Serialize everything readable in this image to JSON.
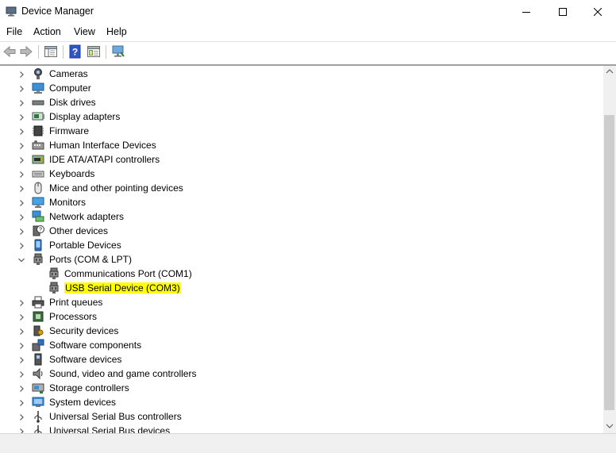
{
  "window": {
    "title": "Device Manager"
  },
  "menu": [
    "File",
    "Action",
    "View",
    "Help"
  ],
  "toolbar": [
    "back-icon",
    "forward-icon",
    "show-hide-tree-icon",
    "help-icon",
    "properties-icon",
    "scan-hardware-icon"
  ],
  "tree": [
    {
      "label": "Cameras",
      "icon": "camera-icon",
      "expanded": false
    },
    {
      "label": "Computer",
      "icon": "computer-icon",
      "expanded": false
    },
    {
      "label": "Disk drives",
      "icon": "disk-drive-icon",
      "expanded": false
    },
    {
      "label": "Display adapters",
      "icon": "display-adapter-icon",
      "expanded": false
    },
    {
      "label": "Firmware",
      "icon": "firmware-icon",
      "expanded": false
    },
    {
      "label": "Human Interface Devices",
      "icon": "hid-icon",
      "expanded": false
    },
    {
      "label": "IDE ATA/ATAPI controllers",
      "icon": "ide-controller-icon",
      "expanded": false
    },
    {
      "label": "Keyboards",
      "icon": "keyboard-icon",
      "expanded": false
    },
    {
      "label": "Mice and other pointing devices",
      "icon": "mouse-icon",
      "expanded": false
    },
    {
      "label": "Monitors",
      "icon": "monitor-icon",
      "expanded": false
    },
    {
      "label": "Network adapters",
      "icon": "network-adapter-icon",
      "expanded": false
    },
    {
      "label": "Other devices",
      "icon": "unknown-device-icon",
      "expanded": false
    },
    {
      "label": "Portable Devices",
      "icon": "portable-device-icon",
      "expanded": false
    },
    {
      "label": "Ports (COM & LPT)",
      "icon": "port-icon",
      "expanded": true,
      "children": [
        {
          "label": "Communications Port (COM1)",
          "icon": "port-icon",
          "highlighted": false
        },
        {
          "label": "USB Serial Device (COM3)",
          "icon": "port-icon",
          "highlighted": true
        }
      ]
    },
    {
      "label": "Print queues",
      "icon": "printer-icon",
      "expanded": false
    },
    {
      "label": "Processors",
      "icon": "processor-icon",
      "expanded": false
    },
    {
      "label": "Security devices",
      "icon": "security-device-icon",
      "expanded": false
    },
    {
      "label": "Software components",
      "icon": "software-component-icon",
      "expanded": false
    },
    {
      "label": "Software devices",
      "icon": "software-device-icon",
      "expanded": false
    },
    {
      "label": "Sound, video and game controllers",
      "icon": "speaker-icon",
      "expanded": false
    },
    {
      "label": "Storage controllers",
      "icon": "storage-controller-icon",
      "expanded": false
    },
    {
      "label": "System devices",
      "icon": "system-device-icon",
      "expanded": false
    },
    {
      "label": "Universal Serial Bus controllers",
      "icon": "usb-icon",
      "expanded": false
    },
    {
      "label": "Universal Serial Bus devices",
      "icon": "usb-icon",
      "expanded": false
    }
  ],
  "colors": {
    "highlight": "#ffff00",
    "accent": "#0078d7"
  }
}
